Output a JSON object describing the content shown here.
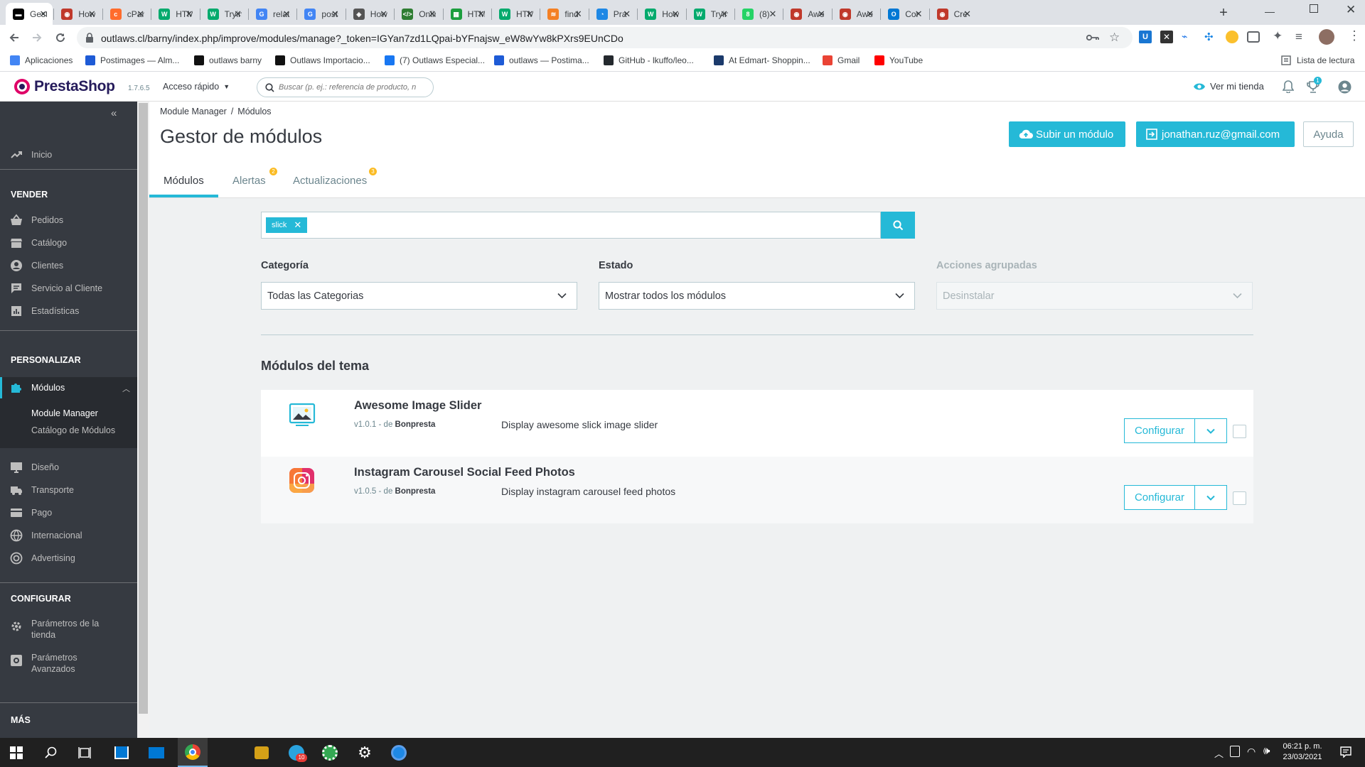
{
  "browser": {
    "tabs": [
      {
        "title": "Gestor",
        "color": "#000000",
        "glyph": "▬"
      },
      {
        "title": "How",
        "color": "#c0392b",
        "glyph": "◉"
      },
      {
        "title": "cPanel",
        "color": "#ff6c2c",
        "glyph": "c"
      },
      {
        "title": "HTML",
        "color": "#04aa6d",
        "glyph": "W"
      },
      {
        "title": "Trying",
        "color": "#04aa6d",
        "glyph": "W"
      },
      {
        "title": "related",
        "color": "#4285f4",
        "glyph": "G"
      },
      {
        "title": "posts",
        "color": "#4285f4",
        "glyph": "G"
      },
      {
        "title": "How",
        "color": "#555555",
        "glyph": "◈"
      },
      {
        "title": "Online",
        "color": "#2e7d32",
        "glyph": "</>"
      },
      {
        "title": "HTML",
        "color": "#1b9e3e",
        "glyph": "▦"
      },
      {
        "title": "HTML",
        "color": "#04aa6d",
        "glyph": "W"
      },
      {
        "title": "find",
        "color": "#f48024",
        "glyph": "≋"
      },
      {
        "title": "Pra",
        "color": "#1e88e5",
        "glyph": "◔"
      },
      {
        "title": "How",
        "color": "#04aa6d",
        "glyph": "W"
      },
      {
        "title": "Trying",
        "color": "#04aa6d",
        "glyph": "W"
      },
      {
        "title": "(8)",
        "color": "#25d366",
        "glyph": "8"
      },
      {
        "title": "Awe",
        "color": "#c0392b",
        "glyph": "◉"
      },
      {
        "title": "Awe",
        "color": "#c0392b",
        "glyph": "◉"
      },
      {
        "title": "Cor",
        "color": "#0078d4",
        "glyph": "O"
      },
      {
        "title": "Cre",
        "color": "#c0392b",
        "glyph": "◉"
      }
    ],
    "url": "outlaws.cl/barny/index.php/improve/modules/manage?_token=IGYan7zd1LQpai-bYFnajsw_eW8wYw8kPXrs9EUnCDo",
    "bookmarks": [
      {
        "label": "Aplicaciones",
        "color": "#4285f4"
      },
      {
        "label": "Postimages — Alm...",
        "color": "#1e5bd6"
      },
      {
        "label": "outlaws barny",
        "color": "#111111"
      },
      {
        "label": "Outlaws Importacio...",
        "color": "#111111"
      },
      {
        "label": "(7) Outlaws Especial...",
        "color": "#1877f2"
      },
      {
        "label": "outlaws — Postima...",
        "color": "#1e5bd6"
      },
      {
        "label": "GitHub - lkuffo/leo...",
        "color": "#24292e"
      },
      {
        "label": "At Edmart- Shoppin...",
        "color": "#1b3a6b"
      },
      {
        "label": "Gmail",
        "color": "#ea4335"
      },
      {
        "label": "YouTube",
        "color": "#ff0000"
      }
    ],
    "reading_list": "Lista de lectura"
  },
  "header": {
    "logo": "PrestaShop",
    "version": "1.7.6.5",
    "quick_access": "Acceso rápido",
    "search_placeholder": "Buscar (p. ej.: referencia de producto, n",
    "view_store": "Ver mi tienda",
    "orders_badge": "1"
  },
  "sidebar": {
    "home": "Inicio",
    "sections": {
      "sell": "VENDER",
      "customize": "PERSONALIZAR",
      "configure": "CONFIGURAR",
      "more": "MÁS"
    },
    "sell_items": [
      "Pedidos",
      "Catálogo",
      "Clientes",
      "Servicio al Cliente",
      "Estadísticas"
    ],
    "modules": "Módulos",
    "modules_sub": [
      "Module Manager",
      "Catálogo de Módulos"
    ],
    "customize_items": [
      "Diseño",
      "Transporte",
      "Pago",
      "Internacional",
      "Advertising"
    ],
    "configure_items": [
      {
        "line1": "Parámetros de la",
        "line2": "tienda"
      },
      {
        "line1": "Parámetros",
        "line2": "Avanzados"
      }
    ]
  },
  "page": {
    "breadcrumb": [
      "Module Manager",
      "Módulos"
    ],
    "title": "Gestor de módulos",
    "upload_button": "Subir un módulo",
    "account_button": "jonathan.ruz@gmail.com",
    "help_button": "Ayuda",
    "tabs": [
      {
        "label": "Módulos",
        "badge": ""
      },
      {
        "label": "Alertas",
        "badge": "2"
      },
      {
        "label": "Actualizaciones",
        "badge": "3"
      }
    ],
    "search_tag": "slick",
    "filters": {
      "category_label": "Categoría",
      "category_value": "Todas las Categorias",
      "status_label": "Estado",
      "status_value": "Mostrar todos los módulos",
      "bulk_label": "Acciones agrupadas",
      "bulk_value": "Desinstalar"
    },
    "section_title": "Módulos del tema",
    "modules": [
      {
        "name": "Awesome Image Slider",
        "version": "v1.0.1 - de",
        "author": "Bonpresta",
        "description": "Display awesome slick image slider",
        "action": "Configurar"
      },
      {
        "name": "Instagram Carousel Social Feed Photos",
        "version": "v1.0.5 - de",
        "author": "Bonpresta",
        "description": "Display instagram carousel feed photos",
        "action": "Configurar"
      }
    ]
  },
  "taskbar": {
    "time": "06:21 p. m.",
    "date": "23/03/2021",
    "telegram_badge": "10"
  },
  "colors": {
    "accent": "#25b9d7",
    "sidebar_bg": "#363a41",
    "badge": "#fbbb22"
  }
}
